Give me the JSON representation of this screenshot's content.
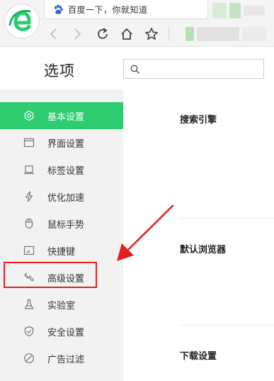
{
  "browser": {
    "tab_title": "百度一下，你就知道",
    "icons": {
      "logo": "browser-logo",
      "back": "back-arrow-icon",
      "forward": "forward-arrow-icon",
      "reload": "reload-icon",
      "home": "home-icon",
      "favorite": "star-icon"
    },
    "accent": "#2dcc70"
  },
  "header": {
    "title": "选项",
    "search_placeholder": ""
  },
  "sidebar": {
    "items": [
      {
        "label": "基本设置",
        "icon": "gear-icon",
        "active": true
      },
      {
        "label": "界面设置",
        "icon": "window-icon",
        "active": false
      },
      {
        "label": "标签设置",
        "icon": "tab-icon",
        "active": false
      },
      {
        "label": "优化加速",
        "icon": "lightning-icon",
        "active": false
      },
      {
        "label": "鼠标手势",
        "icon": "mouse-icon",
        "active": false
      },
      {
        "label": "快捷键",
        "icon": "keyboard-icon",
        "active": false
      },
      {
        "label": "高级设置",
        "icon": "wrench-icon",
        "active": false
      },
      {
        "label": "实验室",
        "icon": "flask-icon",
        "active": false
      },
      {
        "label": "安全设置",
        "icon": "shield-icon",
        "active": false
      },
      {
        "label": "广告过滤",
        "icon": "block-icon",
        "active": false
      }
    ]
  },
  "main": {
    "sections": [
      {
        "title": "搜索引擎"
      },
      {
        "title": "默认浏览器"
      },
      {
        "title": "下载设置"
      }
    ]
  },
  "annotation": {
    "highlight_color": "#e02020"
  }
}
